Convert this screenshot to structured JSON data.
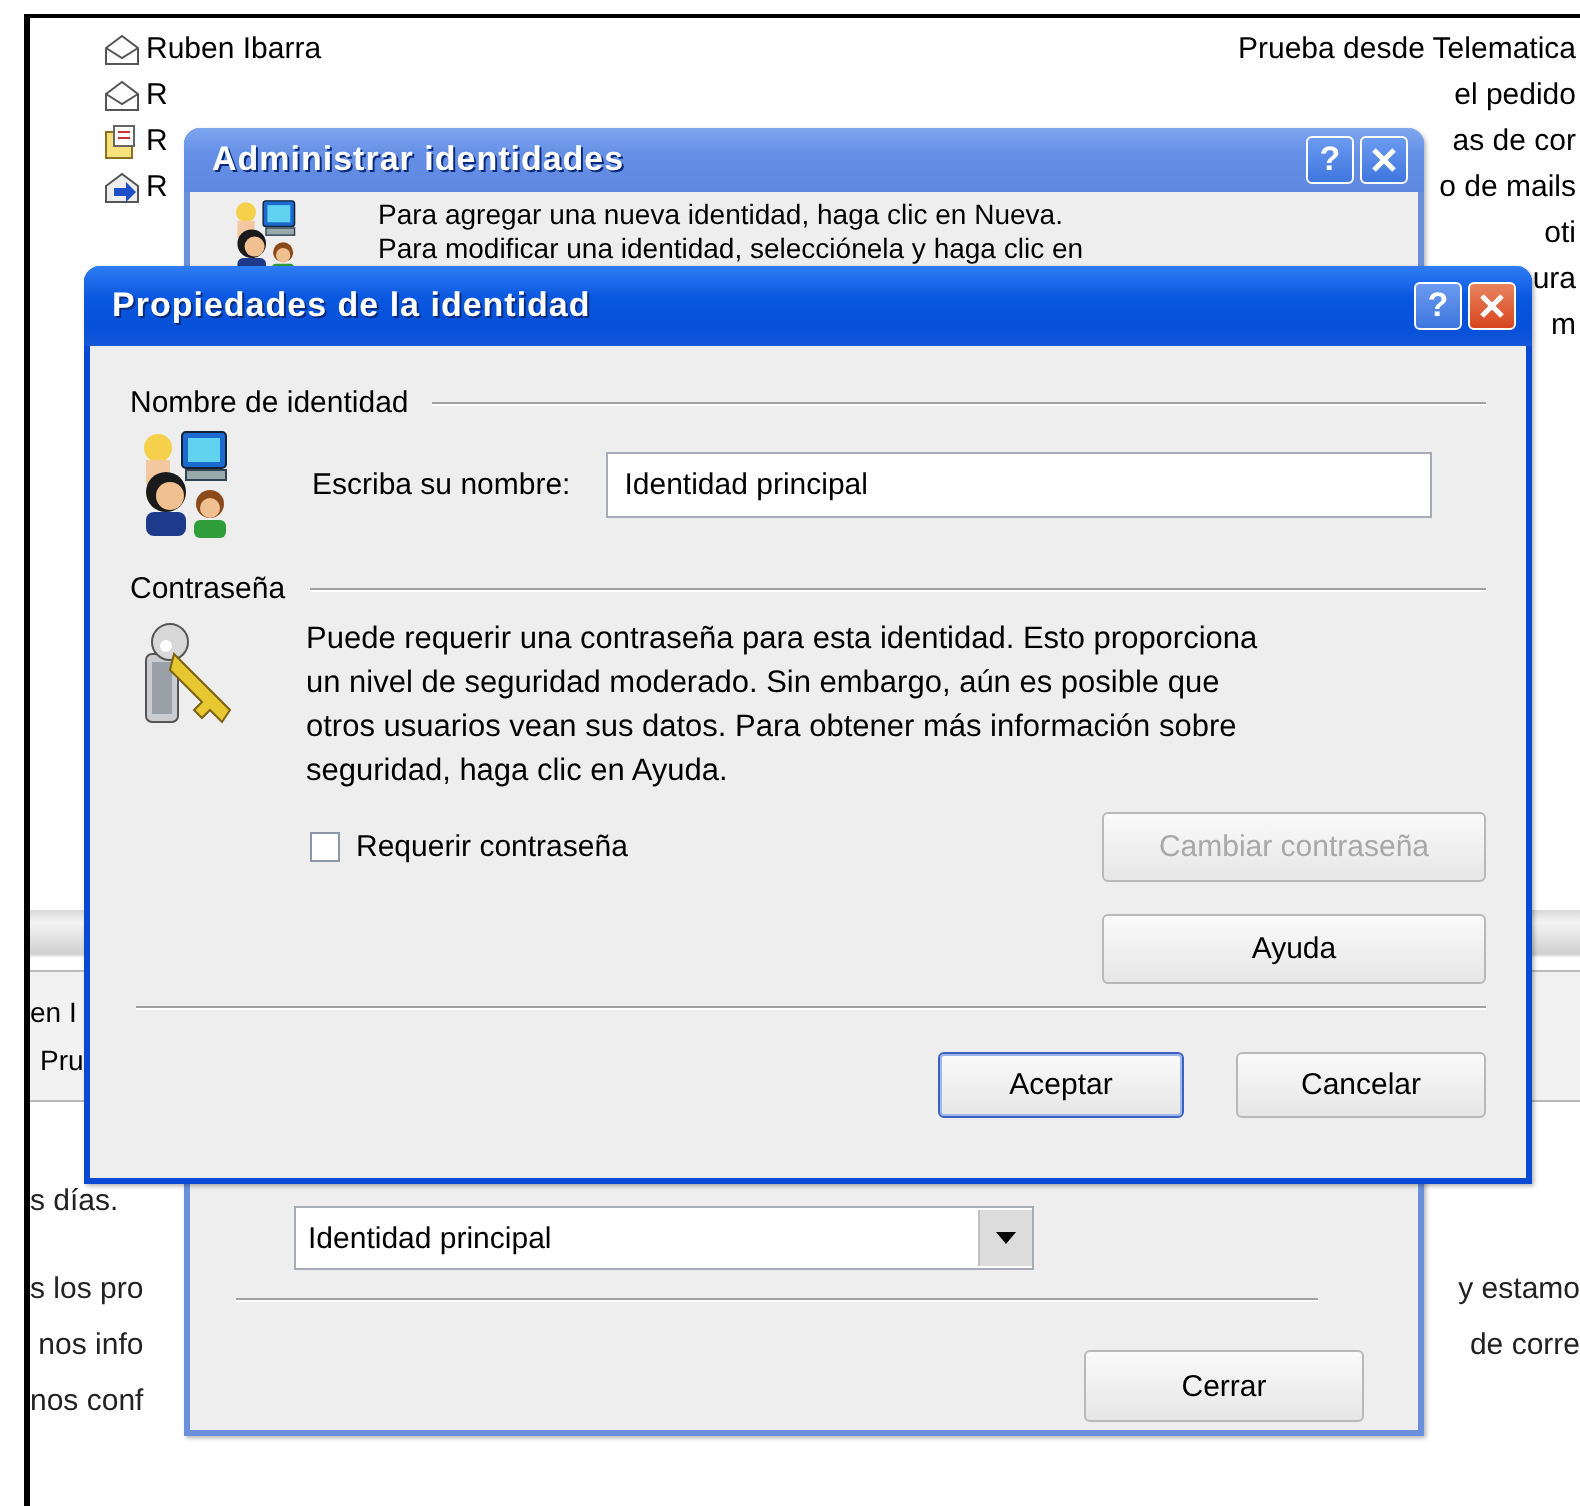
{
  "message_list": {
    "rows": [
      {
        "kind": "read",
        "sender": "Ruben Ibarra",
        "subject": "Prueba desde Telematica"
      },
      {
        "kind": "read",
        "sender": "R",
        "subject": "el pedido"
      },
      {
        "kind": "note",
        "sender": "R",
        "subject": "as de cor"
      },
      {
        "kind": "forwarded",
        "sender": "R",
        "subject": "o de mails"
      },
      {
        "subject": "oti"
      },
      {
        "subject": "ura"
      },
      {
        "subject": "m"
      }
    ]
  },
  "preview_header": [
    "en I",
    "Pru"
  ],
  "preview_body": [
    [
      {
        "left": "s días."
      }
    ],
    [
      {
        "left": "s los pro",
        "right": "y estamo"
      },
      {
        "left": " nos info",
        "right": "de corre"
      },
      {
        "left": "nos conf"
      }
    ]
  ],
  "identity_manager": {
    "title": "Administrar identidades",
    "active": false,
    "help_glyph": "?",
    "intro_lines": [
      "Para agregar una nueva identidad, haga clic en Nueva.",
      "Para modificar una identidad, selecciónela y haga clic en"
    ],
    "startup_identity": "Identidad principal",
    "close_button": "Cerrar"
  },
  "identity_properties": {
    "title": "Propiedades de la identidad",
    "active": true,
    "help_glyph": "?",
    "name_section": {
      "heading": "Nombre de identidad",
      "label": "Escriba su nombre:",
      "value": "Identidad principal"
    },
    "password_section": {
      "heading": "Contraseña",
      "description": "Puede requerir una contraseña para esta identidad.  Esto proporciona\nun nivel de seguridad moderado. Sin embargo, aún es posible que\notros usuarios vean sus datos. Para obtener más información sobre\nseguridad, haga clic en Ayuda.",
      "require_password": {
        "label": "Requerir contraseña",
        "checked": false
      },
      "change_button": {
        "label": "Cambiar contraseña",
        "disabled": true
      },
      "help_button": {
        "label": "Ayuda",
        "disabled": false
      }
    },
    "buttons": [
      {
        "label": "Aceptar",
        "default": true
      },
      {
        "label": "Cancelar",
        "default": false
      }
    ]
  }
}
